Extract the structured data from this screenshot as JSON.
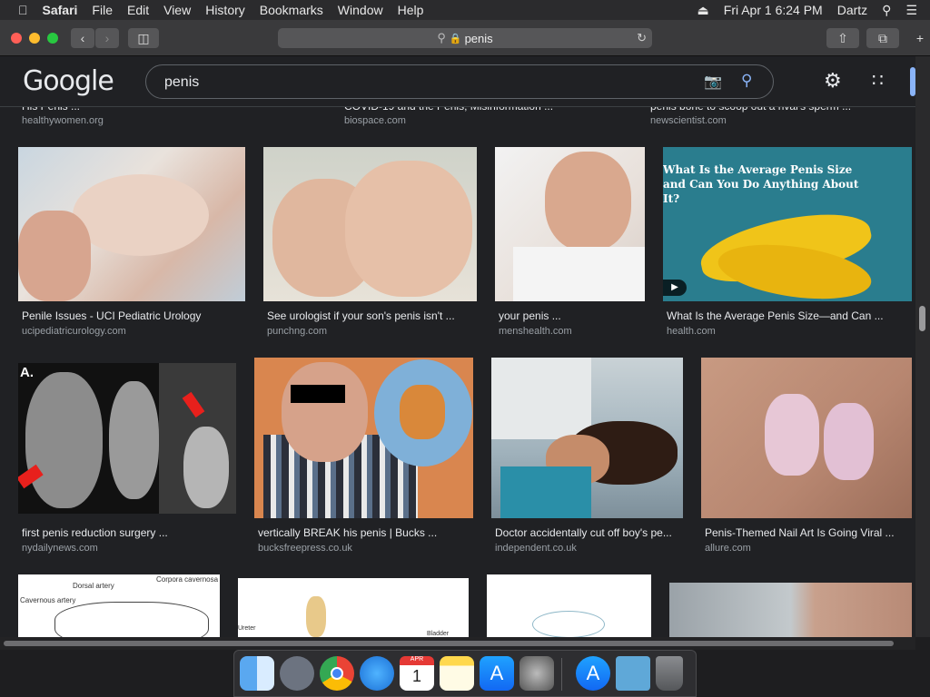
{
  "menubar": {
    "app": "Safari",
    "items": [
      "File",
      "Edit",
      "View",
      "History",
      "Bookmarks",
      "Window",
      "Help"
    ],
    "datetime": "Fri Apr 1  6:24 PM",
    "user": "Dartz"
  },
  "browser": {
    "url": "penis"
  },
  "google": {
    "logo": "Google",
    "query": "penis"
  },
  "top_row": [
    {
      "title": "His Penis ...",
      "domain": "healthywomen.org"
    },
    {
      "title": "COVID-19 and the Penis, Misinformation ...",
      "domain": "biospace.com"
    },
    {
      "title": "penis bone to scoop out a rival's sperm ...",
      "domain": "newscientist.com"
    }
  ],
  "row1": [
    {
      "title": "Penile Issues - UCI Pediatric Urology",
      "domain": "ucipediatricurology.com"
    },
    {
      "title": "See urologist if your son's penis isn't ...",
      "domain": "punchng.com"
    },
    {
      "title": "your penis ...",
      "domain": "menshealth.com"
    },
    {
      "title": "What Is the Average Penis Size—and Can ...",
      "domain": "health.com",
      "overlay": "What Is the Average Penis Size and Can You Do Anything About It?"
    }
  ],
  "row2": [
    {
      "title": "first penis reduction surgery ...",
      "domain": "nydailynews.com",
      "badge": "A."
    },
    {
      "title": "vertically BREAK his penis | Bucks ...",
      "domain": "bucksfreepress.co.uk"
    },
    {
      "title": "Doctor accidentally cut off boy's pe...",
      "domain": "independent.co.uk"
    },
    {
      "title": "Penis-Themed Nail Art Is Going Viral ...",
      "domain": "allure.com"
    }
  ],
  "row3_labels": {
    "a1": "Dorsal artery",
    "a2": "Corpora cavernosa",
    "a3": "Cavernous artery",
    "b1": "Ureter",
    "b2": "Bladder"
  },
  "dock": [
    "finder-icon",
    "launchpad-icon",
    "chrome-icon",
    "safari-icon",
    "calendar-icon",
    "notes-icon",
    "appstore-icon",
    "system-preferences-icon",
    "appstore-icon",
    "downloads-folder-icon",
    "trash-icon"
  ],
  "calendar": {
    "month": "APR",
    "day": "1"
  }
}
